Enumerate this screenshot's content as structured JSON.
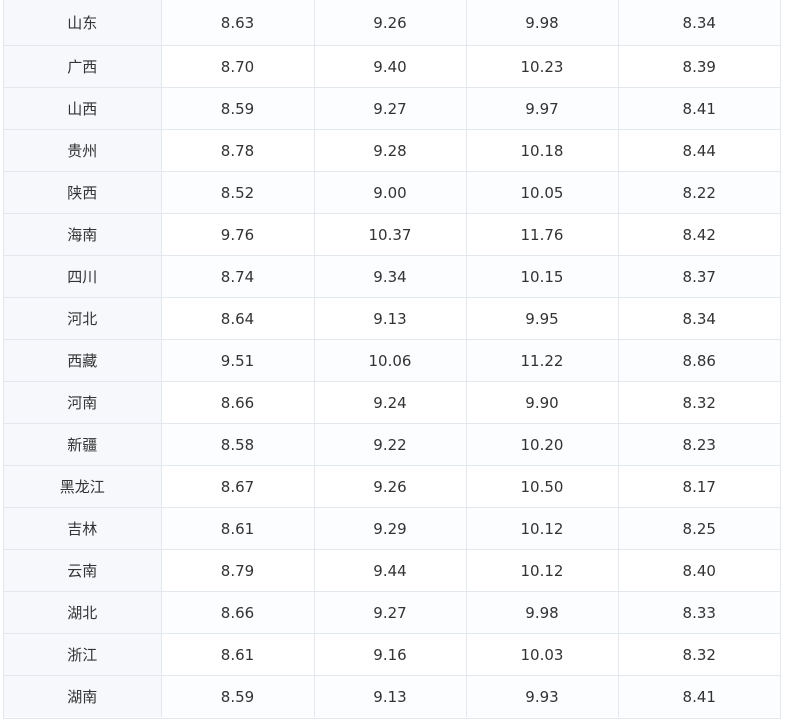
{
  "table": {
    "rows": [
      {
        "province": "山东",
        "values": [
          "8.63",
          "9.26",
          "9.98",
          "8.34"
        ]
      },
      {
        "province": "广西",
        "values": [
          "8.70",
          "9.40",
          "10.23",
          "8.39"
        ]
      },
      {
        "province": "山西",
        "values": [
          "8.59",
          "9.27",
          "9.97",
          "8.41"
        ]
      },
      {
        "province": "贵州",
        "values": [
          "8.78",
          "9.28",
          "10.18",
          "8.44"
        ]
      },
      {
        "province": "陕西",
        "values": [
          "8.52",
          "9.00",
          "10.05",
          "8.22"
        ]
      },
      {
        "province": "海南",
        "values": [
          "9.76",
          "10.37",
          "11.76",
          "8.42"
        ]
      },
      {
        "province": "四川",
        "values": [
          "8.74",
          "9.34",
          "10.15",
          "8.37"
        ]
      },
      {
        "province": "河北",
        "values": [
          "8.64",
          "9.13",
          "9.95",
          "8.34"
        ]
      },
      {
        "province": "西藏",
        "values": [
          "9.51",
          "10.06",
          "11.22",
          "8.86"
        ]
      },
      {
        "province": "河南",
        "values": [
          "8.66",
          "9.24",
          "9.90",
          "8.32"
        ]
      },
      {
        "province": "新疆",
        "values": [
          "8.58",
          "9.22",
          "10.20",
          "8.23"
        ]
      },
      {
        "province": "黑龙江",
        "values": [
          "8.67",
          "9.26",
          "10.50",
          "8.17"
        ]
      },
      {
        "province": "吉林",
        "values": [
          "8.61",
          "9.29",
          "10.12",
          "8.25"
        ]
      },
      {
        "province": "云南",
        "values": [
          "8.79",
          "9.44",
          "10.12",
          "8.40"
        ]
      },
      {
        "province": "湖北",
        "values": [
          "8.66",
          "9.27",
          "9.98",
          "8.33"
        ]
      },
      {
        "province": "浙江",
        "values": [
          "8.61",
          "9.16",
          "10.03",
          "8.32"
        ]
      },
      {
        "province": "湖南",
        "values": [
          "8.59",
          "9.13",
          "9.93",
          "8.41"
        ]
      }
    ]
  }
}
